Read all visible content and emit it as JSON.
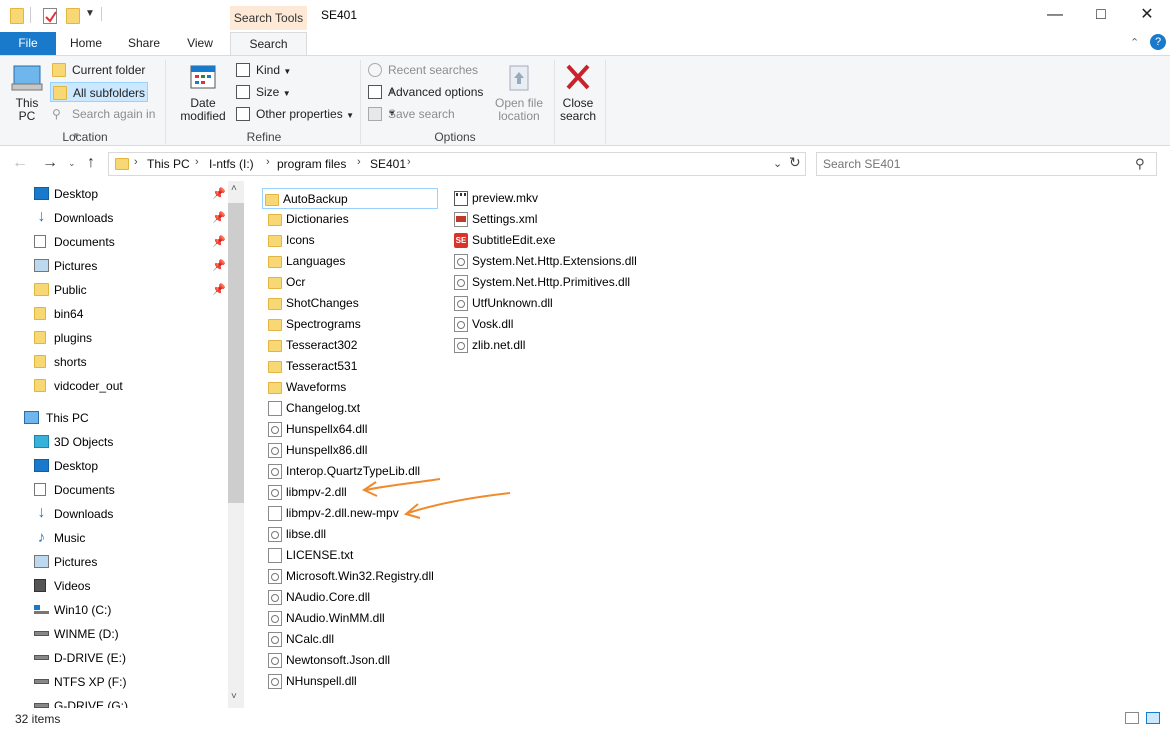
{
  "window": {
    "title": "SE401",
    "context_tab": "Search Tools",
    "minimize": "—",
    "maximize": "□",
    "close": "✕"
  },
  "tabs": {
    "file": "File",
    "home": "Home",
    "share": "Share",
    "view": "View",
    "search": "Search"
  },
  "ribbon": {
    "location": {
      "this_pc_line1": "This",
      "this_pc_line2": "PC",
      "current_folder": "Current folder",
      "all_subfolders": "All subfolders",
      "search_again_in": "Search again in",
      "label": "Location"
    },
    "refine": {
      "date_modified_line1": "Date",
      "date_modified_line2": "modified",
      "kind": "Kind",
      "size": "Size",
      "other_properties": "Other properties",
      "label": "Refine"
    },
    "options": {
      "recent_searches": "Recent searches",
      "advanced_options": "Advanced options",
      "save_search": "Save search",
      "open_file_location_line1": "Open file",
      "open_file_location_line2": "location",
      "label": "Options"
    },
    "close": {
      "line1": "Close",
      "line2": "search"
    }
  },
  "address": {
    "crumbs": [
      "This PC",
      "I-ntfs (I:)",
      "program files",
      "SE401"
    ],
    "search_placeholder": "Search SE401"
  },
  "nav": {
    "quick_access": [
      {
        "label": "Desktop",
        "icon": "desktop-icon",
        "pinned": true
      },
      {
        "label": "Downloads",
        "icon": "downloads-icon",
        "pinned": true
      },
      {
        "label": "Documents",
        "icon": "documents-icon",
        "pinned": true
      },
      {
        "label": "Pictures",
        "icon": "pictures-icon",
        "pinned": true
      },
      {
        "label": "Public",
        "icon": "folder-icon",
        "pinned": true
      },
      {
        "label": "bin64",
        "icon": "folder-icon",
        "pinned": false
      },
      {
        "label": "plugins",
        "icon": "folder-icon",
        "pinned": false
      },
      {
        "label": "shorts",
        "icon": "folder-icon",
        "pinned": false
      },
      {
        "label": "vidcoder_out",
        "icon": "folder-icon",
        "pinned": false
      }
    ],
    "this_pc": "This PC",
    "pc_items": [
      {
        "label": "3D Objects",
        "icon": "3d-objects-icon"
      },
      {
        "label": "Desktop",
        "icon": "desktop-icon"
      },
      {
        "label": "Documents",
        "icon": "documents-icon"
      },
      {
        "label": "Downloads",
        "icon": "downloads-icon"
      },
      {
        "label": "Music",
        "icon": "music-icon"
      },
      {
        "label": "Pictures",
        "icon": "pictures-icon"
      },
      {
        "label": "Videos",
        "icon": "videos-icon"
      },
      {
        "label": "Win10 (C:)",
        "icon": "windows-drive-icon"
      },
      {
        "label": "WINME (D:)",
        "icon": "drive-icon"
      },
      {
        "label": "D-DRIVE (E:)",
        "icon": "drive-icon"
      },
      {
        "label": "NTFS XP (F:)",
        "icon": "drive-icon"
      },
      {
        "label": "G-DRIVE (G:)",
        "icon": "drive-icon"
      }
    ]
  },
  "files": {
    "column1": [
      {
        "name": "AutoBackup",
        "type": "folder"
      },
      {
        "name": "Dictionaries",
        "type": "folder"
      },
      {
        "name": "Icons",
        "type": "folder"
      },
      {
        "name": "Languages",
        "type": "folder"
      },
      {
        "name": "Ocr",
        "type": "folder"
      },
      {
        "name": "ShotChanges",
        "type": "folder"
      },
      {
        "name": "Spectrograms",
        "type": "folder"
      },
      {
        "name": "Tesseract302",
        "type": "folder"
      },
      {
        "name": "Tesseract531",
        "type": "folder"
      },
      {
        "name": "Waveforms",
        "type": "folder"
      },
      {
        "name": "Changelog.txt",
        "type": "txt"
      },
      {
        "name": "Hunspellx64.dll",
        "type": "dll"
      },
      {
        "name": "Hunspellx86.dll",
        "type": "dll"
      },
      {
        "name": "Interop.QuartzTypeLib.dll",
        "type": "dll"
      },
      {
        "name": "libmpv-2.dll",
        "type": "dll"
      },
      {
        "name": "libmpv-2.dll.new-mpv",
        "type": "txt"
      },
      {
        "name": "libse.dll",
        "type": "dll"
      },
      {
        "name": "LICENSE.txt",
        "type": "txt"
      },
      {
        "name": "Microsoft.Win32.Registry.dll",
        "type": "dll"
      },
      {
        "name": "NAudio.Core.dll",
        "type": "dll"
      },
      {
        "name": "NAudio.WinMM.dll",
        "type": "dll"
      },
      {
        "name": "NCalc.dll",
        "type": "dll"
      },
      {
        "name": "Newtonsoft.Json.dll",
        "type": "dll"
      },
      {
        "name": "NHunspell.dll",
        "type": "dll"
      }
    ],
    "column2": [
      {
        "name": "preview.mkv",
        "type": "mkv"
      },
      {
        "name": "Settings.xml",
        "type": "xml"
      },
      {
        "name": "SubtitleEdit.exe",
        "type": "exe"
      },
      {
        "name": "System.Net.Http.Extensions.dll",
        "type": "dll"
      },
      {
        "name": "System.Net.Http.Primitives.dll",
        "type": "dll"
      },
      {
        "name": "UtfUnknown.dll",
        "type": "dll"
      },
      {
        "name": "Vosk.dll",
        "type": "dll"
      },
      {
        "name": "zlib.net.dll",
        "type": "dll"
      }
    ]
  },
  "annotation_color": "#f08a2c",
  "status": {
    "items": "32 items"
  }
}
